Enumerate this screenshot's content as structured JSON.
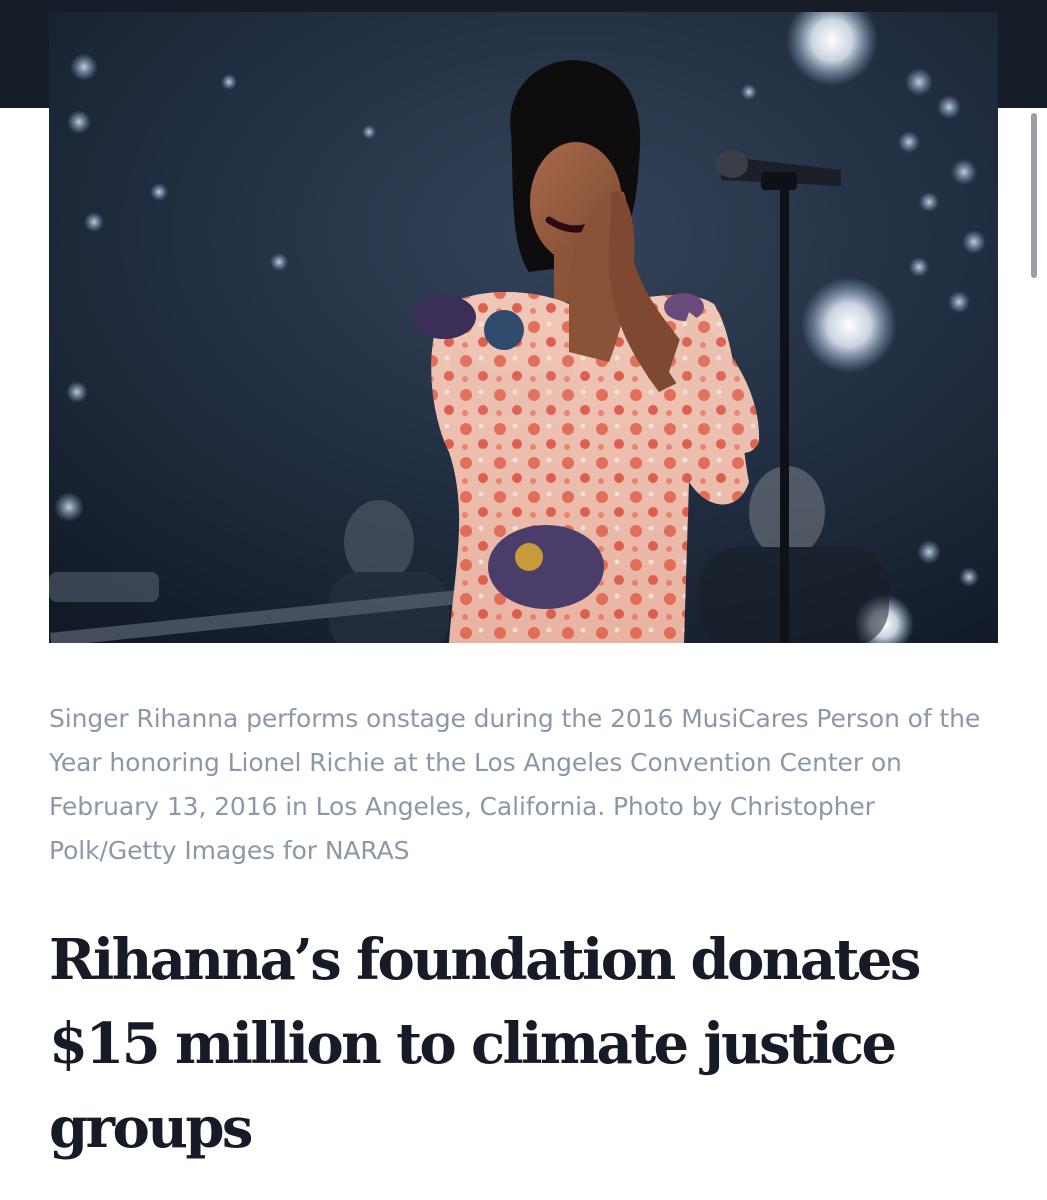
{
  "article": {
    "image": {
      "subject": "Rihanna performing onstage",
      "colors": {
        "background": "#1b2535",
        "dress": "#e06a50",
        "stage_lights": "#c9dcf2"
      }
    },
    "caption": "Singer Rihanna performs onstage during the 2016 MusiCares Person of the Year honoring Lionel Richie at the Los Angeles Convention Center on February 13, 2016 in Los Angeles, California. Photo by Christopher Polk/Getty Images for NARAS",
    "headline": "Rihanna’s foundation donates $15 million to climate justice groups"
  },
  "colors": {
    "header_bar": "#161c28",
    "caption_text": "#8c98a8",
    "headline_text": "#171b27"
  }
}
